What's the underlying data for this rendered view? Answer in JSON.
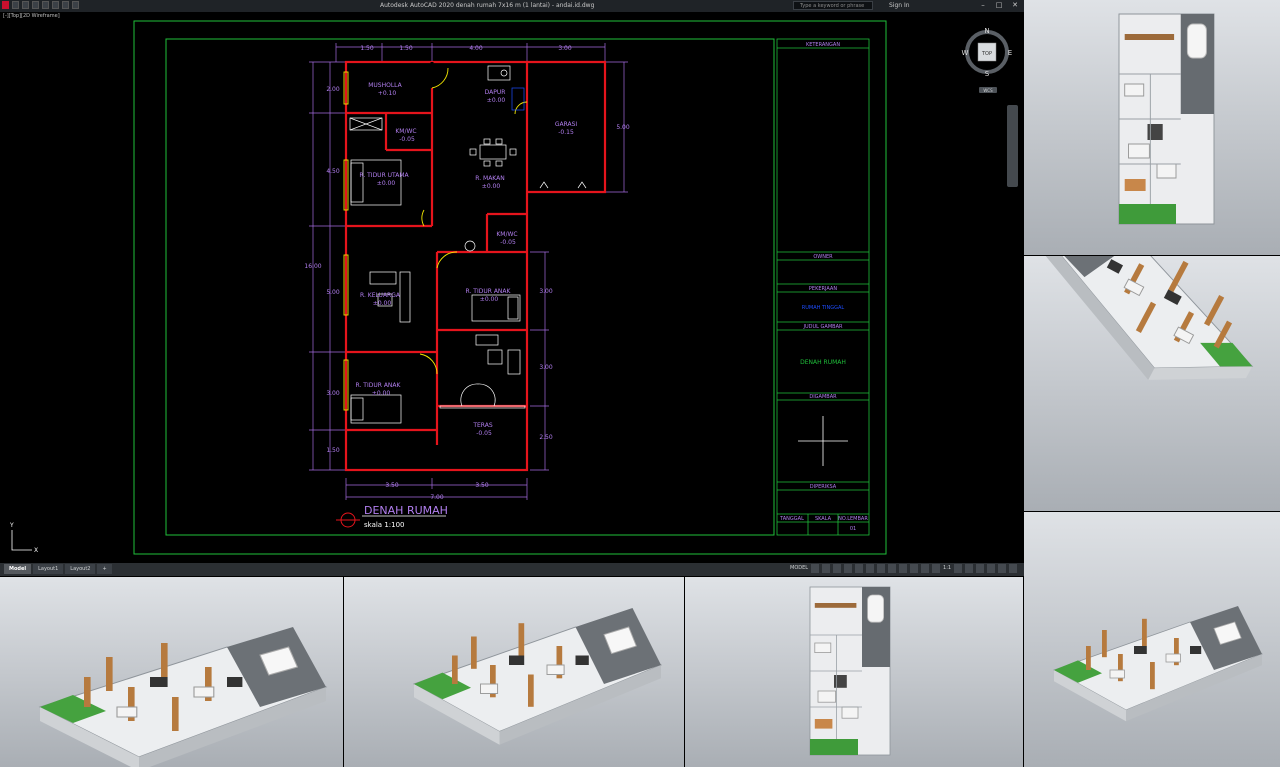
{
  "app": {
    "title": "Autodesk AutoCAD 2020   denah rumah 7x16 m (1 lantai) - andai.id.dwg",
    "search_placeholder": "Type a keyword or phrase",
    "sign_in": "Sign In",
    "view_label": "[-][Top][2D Wireframe]"
  },
  "viewcube": {
    "n": "N",
    "s": "S",
    "e": "E",
    "w": "W",
    "top": "TOP",
    "wcs": "WCS"
  },
  "ucs": {
    "x": "X",
    "y": "Y"
  },
  "drawing": {
    "dims_top": [
      "1.50",
      "1.50",
      "4.00",
      "3.00"
    ],
    "dims_left": [
      "2.00",
      "4.50",
      "5.00",
      "3.00",
      "1.50"
    ],
    "dim_overall_left": "16.00",
    "dims_right_upper": "5.00",
    "dims_right": [
      "3.00",
      "3.00",
      "2.50"
    ],
    "dims_bottom": [
      "3.50",
      "3.50"
    ],
    "dim_overall_bottom": "7.00",
    "rooms": {
      "musholla": "MUSHOLLA",
      "musholla_lvl": "+0.10",
      "dapur": "DAPUR",
      "dapur_lvl": "±0.00",
      "garasi": "GARASI",
      "garasi_lvl": "-0.15",
      "kmwc1": "KM/WC",
      "kmwc1_lvl": "-0.05",
      "tidur_utama": "R. TIDUR UTAMA",
      "tidur_utama_lvl": "±0.00",
      "makan": "R. MAKAN",
      "makan_lvl": "±0.00",
      "kmwc2": "KM/WC",
      "kmwc2_lvl": "-0.05",
      "keluarga": "R. KELUARGA",
      "keluarga_lvl": "±0.00",
      "tidur_anak1": "R. TIDUR ANAK",
      "tidur_anak1_lvl": "±0.00",
      "tidur_anak2": "R. TIDUR ANAK",
      "tidur_anak2_lvl": "±0.00",
      "teras": "TERAS",
      "teras_lvl": "-0.05"
    },
    "plan_title": "DENAH RUMAH",
    "plan_scale": "skala  1:100"
  },
  "titleblock": {
    "keterangan": "KETERANGAN",
    "owner": "OWNER",
    "pekerjaan": "PEKERJAAN",
    "pekerjaan_value": "RUMAH TINGGAL",
    "judul": "JUDUL GAMBAR",
    "judul_value": "DENAH RUMAH",
    "digambar": "DIGAMBAR",
    "diperiksa": "DIPERIKSA",
    "tanggal": "TANGGAL",
    "skala": "SKALA",
    "no_lembar": "NO.LEMBAR",
    "no_lembar_value": "01"
  },
  "status": {
    "tabs": [
      "Model",
      "Layout1",
      "Layout2"
    ],
    "add_tab": "+",
    "mode": "MODEL",
    "scale": "1:1"
  },
  "colors": {
    "wall": "#e5141c",
    "dim": "#a46be0",
    "text": "#b27ff0",
    "frame": "#1fbf3a",
    "furniture": "#ffffff",
    "door": "#f2e600",
    "blue": "#1d4dff"
  },
  "renders": [
    {
      "label": "top-view-render-1"
    },
    {
      "label": "iso-render-1"
    },
    {
      "label": "iso-render-2"
    },
    {
      "label": "iso-render-3"
    },
    {
      "label": "top-view-render-2"
    },
    {
      "label": "iso-render-4"
    }
  ]
}
